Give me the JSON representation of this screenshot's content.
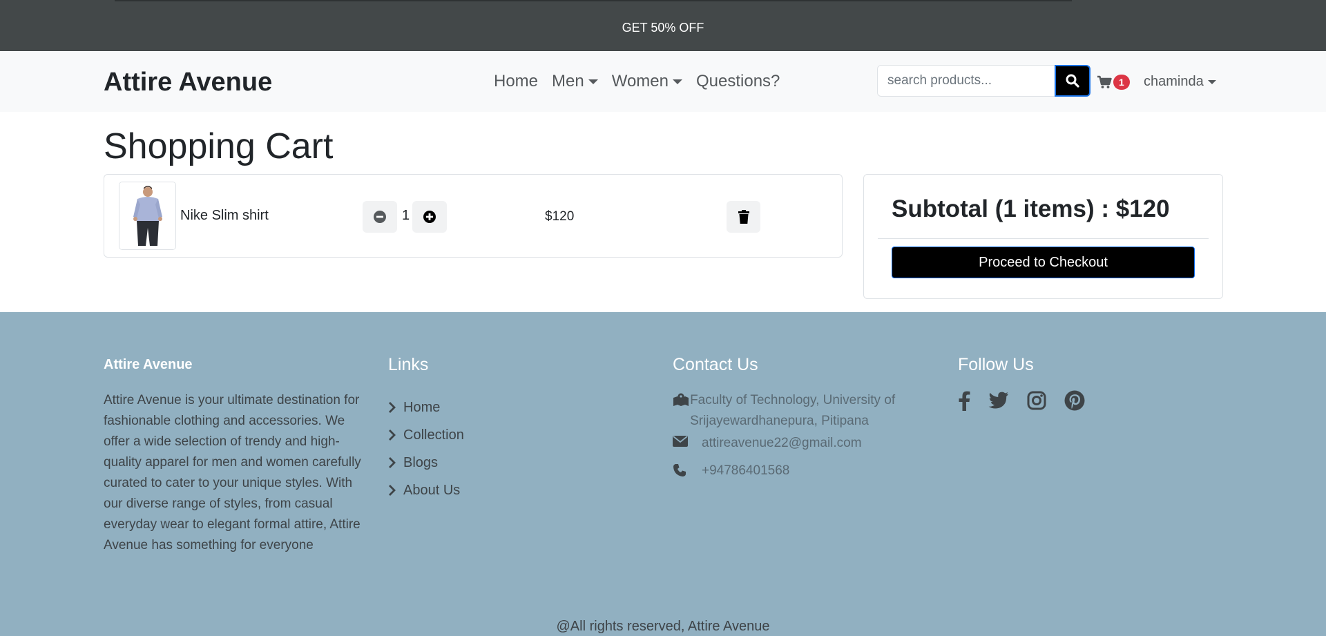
{
  "promo": {
    "text": "GET 50% OFF"
  },
  "navbar": {
    "brand": "Attire Avenue",
    "links": [
      {
        "label": "Home"
      },
      {
        "label": "Men"
      },
      {
        "label": "Women"
      },
      {
        "label": "Questions?"
      }
    ],
    "search": {
      "placeholder": "search products...",
      "value": ""
    },
    "cart_count": "1",
    "user": "chaminda"
  },
  "cart": {
    "title": "Shopping Cart",
    "items": [
      {
        "name": "Nike Slim shirt",
        "quantity": "1",
        "price": "$120"
      }
    ]
  },
  "summary": {
    "subtotal": "Subtotal (1 items) : $120",
    "checkout_label": "Proceed to Checkout"
  },
  "footer": {
    "brand": "Attire Avenue",
    "about": "Attire Avenue is your ultimate destination for fashionable clothing and accessories. We offer a wide selection of trendy and high-quality apparel for men and women carefully curated to cater to your unique styles. With our diverse range of styles, from casual everyday wear to elegant formal attire, Attire Avenue has something for everyone",
    "links_heading": "Links",
    "links": [
      {
        "label": "Home"
      },
      {
        "label": "Collection"
      },
      {
        "label": "Blogs"
      },
      {
        "label": "About Us"
      }
    ],
    "contact_heading": "Contact Us",
    "contact": {
      "address": "Faculty of Technology, University of Srijayewardhanepura, Pitipana",
      "email": "attireavenue22@gmail.com",
      "phone": "+94786401568"
    },
    "follow_heading": "Follow Us",
    "social_icons": [
      "facebook-icon",
      "twitter-icon",
      "instagram-icon",
      "pinterest-icon"
    ],
    "copyright": "@All rights reserved, Attire Avenue"
  }
}
